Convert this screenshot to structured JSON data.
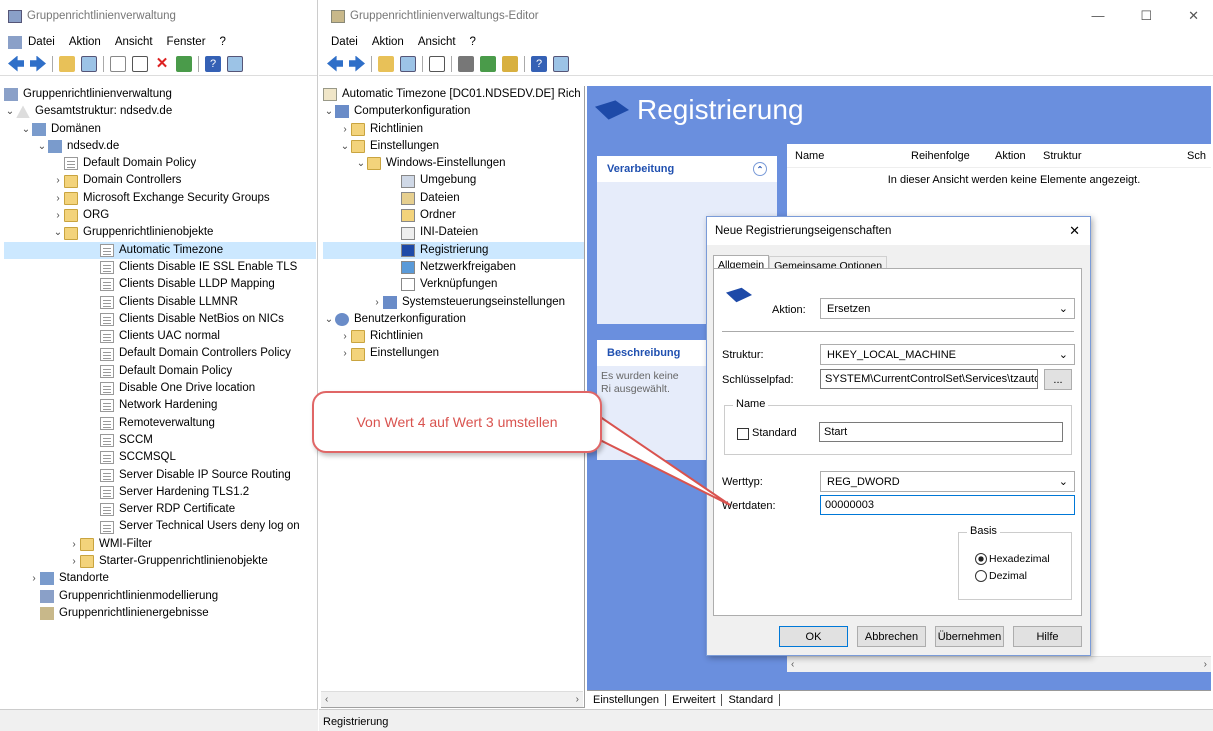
{
  "left_window": {
    "title": "Gruppenrichtlinienverwaltung",
    "menu": [
      "Datei",
      "Aktion",
      "Ansicht",
      "Fenster",
      "?"
    ],
    "tree": {
      "root": "Gruppenrichtlinienverwaltung",
      "forest": "Gesamtstruktur: ndsedv.de",
      "domains": "Domänen",
      "domain": "ndsedv.de",
      "default_policy": "Default Domain Policy",
      "domain_controllers": "Domain Controllers",
      "exchange": "Microsoft Exchange Security Groups",
      "org": "ORG",
      "gpo_container": "Gruppenrichtlinienobjekte",
      "gpos": [
        "Automatic Timezone",
        "Clients Disable IE SSL Enable TLS",
        "Clients Disable LLDP Mapping",
        "Clients Disable LLMNR",
        "Clients Disable NetBios on NICs",
        "Clients UAC normal",
        "Default Domain Controllers Policy",
        "Default Domain Policy",
        "Disable One Drive location",
        "Network Hardening",
        "Remoteverwaltung",
        "SCCM",
        "SCCMSQL",
        "Server Disable IP Source Routing",
        "Server Hardening TLS1.2",
        "Server RDP Certificate",
        "Server Technical Users deny log on"
      ],
      "wmi": "WMI-Filter",
      "starter": "Starter-Gruppenrichtlinienobjekte",
      "sites": "Standorte",
      "modeling": "Gruppenrichtlinienmodellierung",
      "results": "Gruppenrichtlinienergebnisse"
    }
  },
  "editor_window": {
    "title": "Gruppenrichtlinienverwaltungs-Editor",
    "menu": [
      "Datei",
      "Aktion",
      "Ansicht",
      "?"
    ],
    "window_controls": {
      "minimize": "—",
      "maximize": "☐",
      "close": "✕"
    },
    "tree": {
      "root": "Automatic Timezone [DC01.NDSEDV.DE] Rich",
      "computer": "Computerkonfiguration",
      "policies": "Richtlinien",
      "settings": "Einstellungen",
      "windows_settings": "Windows-Einstellungen",
      "items": [
        "Umgebung",
        "Dateien",
        "Ordner",
        "INI-Dateien",
        "Registrierung",
        "Netzwerkfreigaben",
        "Verknüpfungen"
      ],
      "control_panel": "Systemsteuerungseinstellungen",
      "user": "Benutzerkonfiguration",
      "user_policies": "Richtlinien",
      "user_settings": "Einstellungen"
    },
    "status": "Registrierung",
    "header_title": "Registrierung",
    "processing_label": "Verarbeitung",
    "description_label": "Beschreibung",
    "description_text": "Es wurden keine Ri ausgewählt.",
    "columns": [
      "Name",
      "Reihenfolge",
      "Aktion",
      "Struktur",
      "Sch"
    ],
    "empty_text": "In dieser Ansicht werden keine Elemente angezeigt.",
    "bottom_tabs": [
      "Einstellungen",
      "Erweitert",
      "Standard"
    ]
  },
  "dialog": {
    "title": "Neue Registrierungseigenschaften",
    "tabs": [
      "Allgemein",
      "Gemeinsame Optionen"
    ],
    "action_label": "Aktion:",
    "action_value": "Ersetzen",
    "hive_label": "Struktur:",
    "hive_value": "HKEY_LOCAL_MACHINE",
    "keypath_label": "Schlüsselpfad:",
    "keypath_value": "SYSTEM\\CurrentControlSet\\Services\\tzautoup",
    "browse": "...",
    "name_group": "Name",
    "default_label": "Standard",
    "name_value": "Start",
    "type_label": "Werttyp:",
    "type_value": "REG_DWORD",
    "data_label": "Wertdaten:",
    "data_value": "00000003",
    "base_group": "Basis",
    "hex_label": "Hexadezimal",
    "dec_label": "Dezimal",
    "ok": "OK",
    "cancel": "Abbrechen",
    "apply": "Übernehmen",
    "help": "Hilfe",
    "close": "✕"
  },
  "callout": {
    "text": "Von Wert 4 auf Wert 3 umstellen"
  },
  "colors": {
    "accent": "#6a8fde",
    "callout_border": "#d9534f",
    "selection": "#cce8ff"
  }
}
